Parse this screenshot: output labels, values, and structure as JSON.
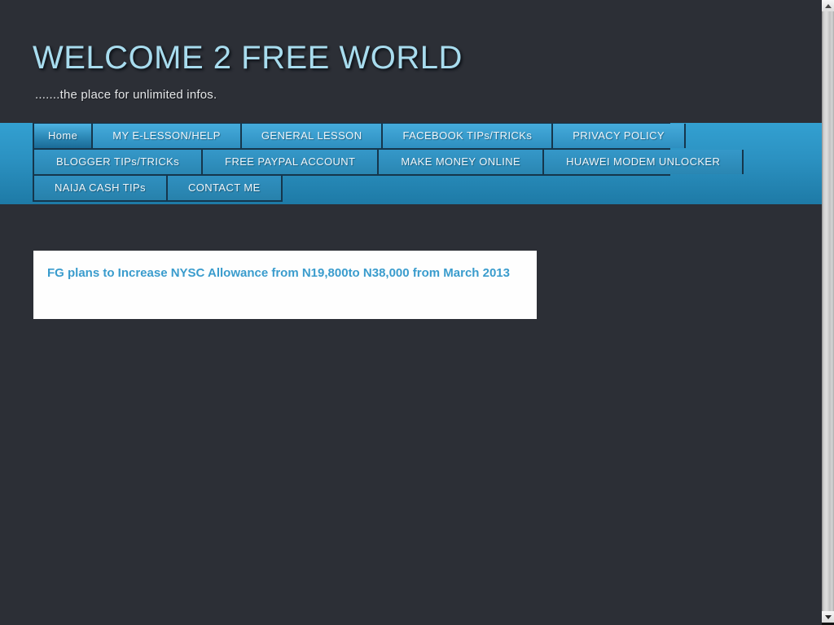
{
  "header": {
    "title": "WELCOME 2 FREE WORLD",
    "subtitle": ".......the place for unlimited infos."
  },
  "nav": {
    "rows": [
      {
        "items": [
          {
            "label": "Home",
            "active": true
          },
          {
            "label": "MY E-LESSON/HELP",
            "active": false
          },
          {
            "label": "GENERAL LESSON",
            "active": false
          },
          {
            "label": "FACEBOOK TIPs/TRICKs",
            "active": false
          },
          {
            "label": "PRIVACY POLICY",
            "active": false
          }
        ]
      },
      {
        "items": [
          {
            "label": "BLOGGER TIPs/TRICKs",
            "active": false
          },
          {
            "label": "FREE PAYPAL ACCOUNT",
            "active": false
          },
          {
            "label": "MAKE MONEY ONLINE",
            "active": false
          },
          {
            "label": "HUAWEI MODEM UNLOCKER",
            "active": false
          }
        ]
      },
      {
        "items": [
          {
            "label": "NAIJA CASH TIPs",
            "active": false
          },
          {
            "label": "CONTACT ME",
            "active": false
          }
        ]
      }
    ]
  },
  "main": {
    "post_title": "FG plans to Increase NYSC Allowance from N19,800to N38,000 from March 2013"
  },
  "scrollbar": {
    "up_icon": "scroll-up-arrow",
    "down_icon": "scroll-down-arrow"
  },
  "colors": {
    "page_background": "#2c2f36",
    "title_blue": "#a8dcee",
    "nav_blue_top": "#33a0d1",
    "nav_blue_bottom": "#1e7aa6",
    "tab_border": "#15364c",
    "post_title_blue": "#3a9ccd",
    "post_card_background": "#fefefe"
  }
}
